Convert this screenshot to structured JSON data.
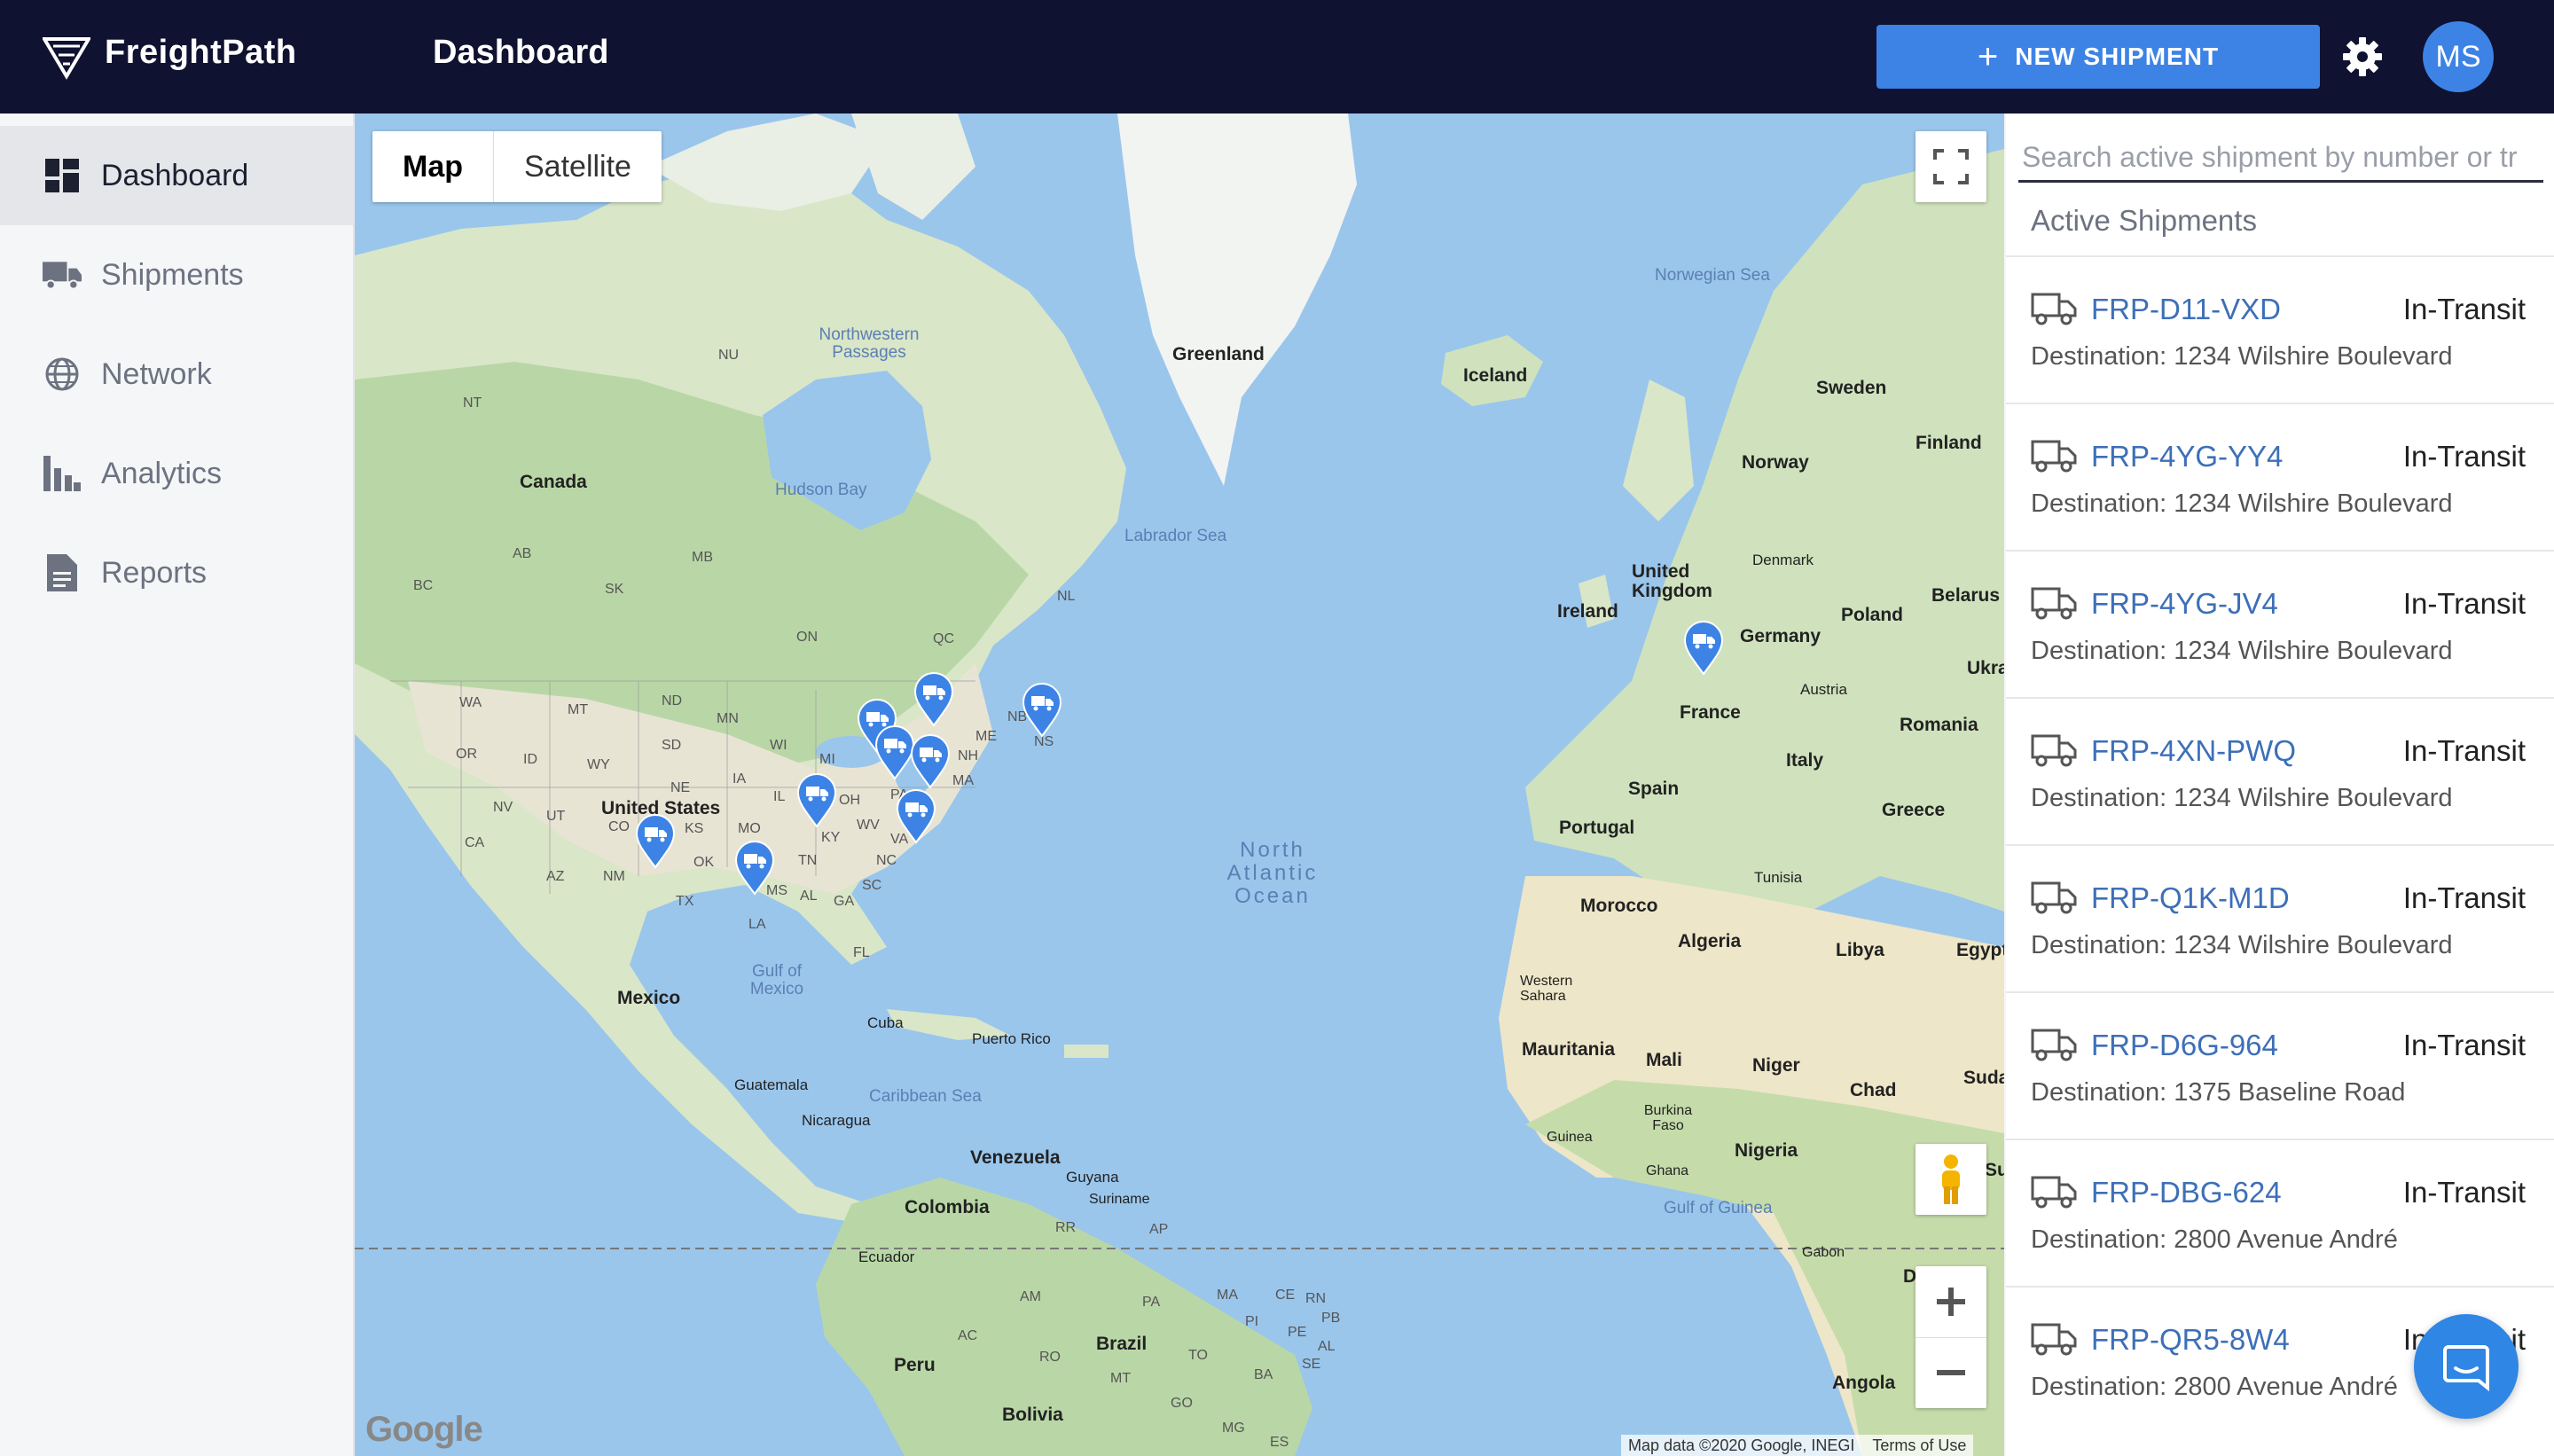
{
  "header": {
    "brand": "FreightPath",
    "page_title": "Dashboard",
    "new_shipment_label": "NEW SHIPMENT",
    "avatar_initials": "MS",
    "background_color": "#0f1230",
    "accent_color": "#3d83e6"
  },
  "sidebar": {
    "items": [
      {
        "label": "Dashboard",
        "icon": "dashboard-icon",
        "active": true
      },
      {
        "label": "Shipments",
        "icon": "truck-icon",
        "active": false
      },
      {
        "label": "Network",
        "icon": "globe-icon",
        "active": false
      },
      {
        "label": "Analytics",
        "icon": "bar-chart-icon",
        "active": false
      },
      {
        "label": "Reports",
        "icon": "document-icon",
        "active": false
      }
    ]
  },
  "map": {
    "map_type_options": [
      "Map",
      "Satellite"
    ],
    "selected_map_type": "Map",
    "attribution": "Map data ©2020 Google, INEGI",
    "terms": "Terms of Use",
    "provider_logo": "Google",
    "labels": {
      "greenland": "Greenland",
      "iceland": "Iceland",
      "norwegian_sea": "Norwegian Sea",
      "northwestern_passages": "Northwestern Passages",
      "nu": "NU",
      "nt": "NT",
      "canada": "Canada",
      "hudson_bay": "Hudson Bay",
      "labrador_sea": "Labrador Sea",
      "ab": "AB",
      "bc": "BC",
      "sk": "SK",
      "mb": "MB",
      "on": "ON",
      "qc": "QC",
      "nl": "NL",
      "wa": "WA",
      "mt": "MT",
      "nd": "ND",
      "mn": "MN",
      "or": "OR",
      "id": "ID",
      "wy": "WY",
      "sd": "SD",
      "wi": "WI",
      "mi": "MI",
      "nv": "NV",
      "ut": "UT",
      "ca": "CA",
      "co": "CO",
      "ne": "NE",
      "ia": "IA",
      "il": "IL",
      "oh": "OH",
      "ks": "KS",
      "mo": "MO",
      "ky": "KY",
      "wv": "WV",
      "va": "VA",
      "az": "AZ",
      "nm": "NM",
      "ok": "OK",
      "tn": "TN",
      "nc": "NC",
      "tx": "TX",
      "ms": "MS",
      "al": "AL",
      "ga": "GA",
      "sc": "SC",
      "la": "LA",
      "fl": "FL",
      "pa": "PA",
      "nh": "NH",
      "ma": "MA",
      "me": "ME",
      "ns": "NS",
      "nb": "NB",
      "united_states": "United States",
      "mexico": "Mexico",
      "gulf_of_mexico": "Gulf of Mexico",
      "cuba": "Cuba",
      "puerto_rico": "Puerto Rico",
      "guatemala": "Guatemala",
      "nicaragua": "Nicaragua",
      "caribbean_sea": "Caribbean Sea",
      "venezuela": "Venezuela",
      "guyana": "Guyana",
      "suriname": "Suriname",
      "colombia": "Colombia",
      "ecuador": "Ecuador",
      "rr": "RR",
      "ap": "AP",
      "am": "AM",
      "pa_br": "PA",
      "ma_br": "MA",
      "ce": "CE",
      "rn": "RN",
      "pb": "PB",
      "pi": "PI",
      "pe": "PE",
      "ac": "AC",
      "ro": "RO",
      "to": "TO",
      "al_br": "AL",
      "ba": "BA",
      "se": "SE",
      "mt_br": "MT",
      "go": "GO",
      "mg": "MG",
      "es": "ES",
      "brazil": "Brazil",
      "peru": "Peru",
      "bolivia": "Bolivia",
      "north_atlantic_ocean": "North Atlantic Ocean",
      "sweden": "Sweden",
      "finland": "Finland",
      "norway": "Norway",
      "denmark": "Denmark",
      "united_kingdom": "United Kingdom",
      "ireland": "Ireland",
      "belarus": "Belarus",
      "ukraine": "Ukra",
      "poland": "Poland",
      "germany": "Germany",
      "austria": "Austria",
      "romania": "Romania",
      "france": "France",
      "italy": "Italy",
      "spain": "Spain",
      "portugal": "Portugal",
      "greece": "Greece",
      "tunisia": "Tunisia",
      "morocco": "Morocco",
      "algeria": "Algeria",
      "libya": "Libya",
      "egypt": "Egypt",
      "western_sahara": "Western Sahara",
      "mauritania": "Mauritania",
      "mali": "Mali",
      "niger": "Niger",
      "chad": "Chad",
      "sudan": "Suda",
      "burkina_faso": "Burkina Faso",
      "guinea": "Guinea",
      "ghana": "Ghana",
      "nigeria": "Nigeria",
      "gulf_of_guinea": "Gulf of Guinea",
      "gabon": "Gabon",
      "angola": "Angola",
      "su": "Su",
      "d": "D"
    }
  },
  "panel": {
    "search_placeholder": "Search active shipment by number or tr",
    "title": "Active Shipments",
    "shipments": [
      {
        "number": "FRP-D11-VXD",
        "status": "In-Transit",
        "destination": "Destination: 1234 Wilshire Boulevard"
      },
      {
        "number": "FRP-4YG-YY4",
        "status": "In-Transit",
        "destination": "Destination: 1234 Wilshire Boulevard"
      },
      {
        "number": "FRP-4YG-JV4",
        "status": "In-Transit",
        "destination": "Destination: 1234 Wilshire Boulevard"
      },
      {
        "number": "FRP-4XN-PWQ",
        "status": "In-Transit",
        "destination": "Destination: 1234 Wilshire Boulevard"
      },
      {
        "number": "FRP-Q1K-M1D",
        "status": "In-Transit",
        "destination": "Destination: 1234 Wilshire Boulevard"
      },
      {
        "number": "FRP-D6G-964",
        "status": "In-Transit",
        "destination": "Destination: 1375 Baseline Road"
      },
      {
        "number": "FRP-DBG-624",
        "status": "In-Transit",
        "destination": "Destination: 2800 Avenue André"
      },
      {
        "number": "FRP-QR5-8W4",
        "status": "In-Transit",
        "destination": "Destination: 2800 Avenue André"
      }
    ]
  }
}
